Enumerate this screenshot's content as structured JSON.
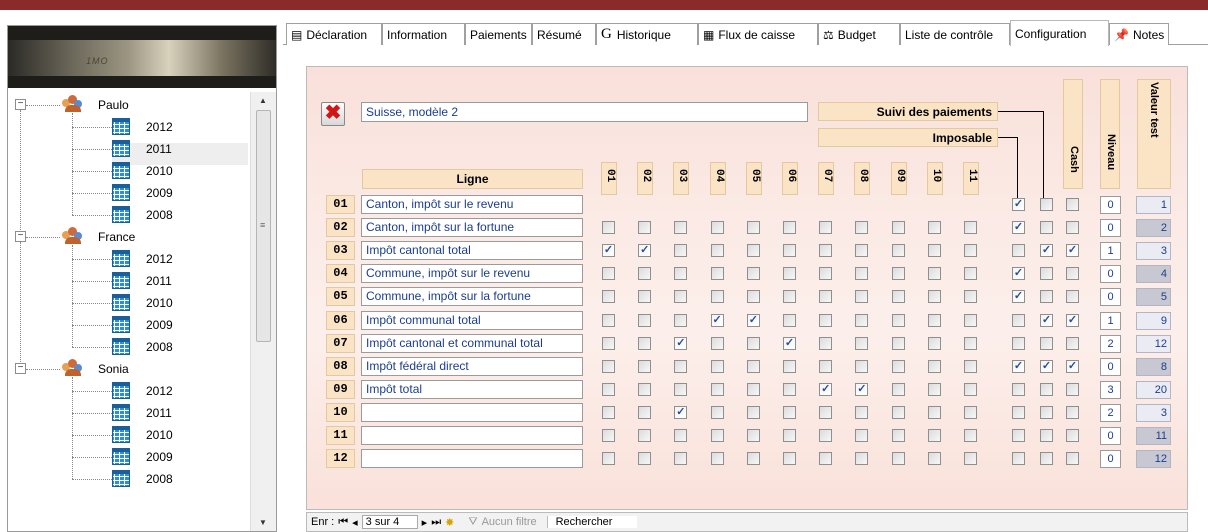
{
  "tree": {
    "banner_text": "1MO",
    "groups": [
      {
        "name": "Paulo",
        "years": [
          "2012",
          "2011",
          "2010",
          "2009",
          "2008"
        ]
      },
      {
        "name": "France",
        "years": [
          "2012",
          "2011",
          "2010",
          "2009",
          "2008"
        ]
      },
      {
        "name": "Sonia",
        "years": [
          "2012",
          "2011",
          "2010",
          "2009",
          "2008"
        ]
      }
    ]
  },
  "tabs": [
    {
      "label": "Déclaration",
      "icon": "form-icon"
    },
    {
      "label": "Information",
      "icon": ""
    },
    {
      "label": "Paiements",
      "icon": ""
    },
    {
      "label": "Résumé",
      "icon": ""
    },
    {
      "label": "Historique",
      "icon": "g-icon"
    },
    {
      "label": "Flux de caisse",
      "icon": "table-icon"
    },
    {
      "label": "Budget",
      "icon": "scale-icon"
    },
    {
      "label": "Liste de contrôle",
      "icon": ""
    },
    {
      "label": "Configuration",
      "icon": ""
    },
    {
      "label": "Notes",
      "icon": "pin-icon"
    }
  ],
  "active_tab": "Configuration",
  "form": {
    "model_name": "Suisse, modèle 2",
    "suivi_label": "Suivi des paiements",
    "imposable_label": "Imposable",
    "ligne_label": "Ligne",
    "cash_label": "Cash",
    "niveau_label": "Niveau",
    "valeur_test_label": "Valeur test",
    "columns": [
      "01",
      "02",
      "03",
      "04",
      "05",
      "06",
      "07",
      "08",
      "09",
      "10",
      "11"
    ],
    "rows": [
      {
        "num": "01",
        "name": "Canton, impôt sur le revenu",
        "checks": [
          0,
          0,
          0,
          0,
          0,
          0,
          0,
          0,
          0,
          0,
          0
        ],
        "visible": [
          0,
          0,
          0,
          0,
          0,
          0,
          0,
          0,
          0,
          0,
          0
        ],
        "imposable": 1,
        "suivi": 0,
        "cash": 0,
        "niveau": "0",
        "valeur": "1"
      },
      {
        "num": "02",
        "name": "Canton, impôt sur la fortune",
        "checks": [
          0,
          0,
          0,
          0,
          0,
          0,
          0,
          0,
          0,
          0,
          0
        ],
        "visible": [
          1,
          1,
          1,
          1,
          1,
          1,
          1,
          1,
          1,
          1,
          1
        ],
        "imposable": 1,
        "suivi": 0,
        "cash": 0,
        "niveau": "0",
        "valeur": "2"
      },
      {
        "num": "03",
        "name": "Impôt cantonal total",
        "checks": [
          1,
          1,
          0,
          0,
          0,
          0,
          0,
          0,
          0,
          0,
          0
        ],
        "visible": [
          1,
          1,
          1,
          1,
          1,
          1,
          1,
          1,
          1,
          1,
          1
        ],
        "imposable": 0,
        "suivi": 1,
        "cash": 1,
        "niveau": "1",
        "valeur": "3"
      },
      {
        "num": "04",
        "name": "Commune, impôt sur le revenu",
        "checks": [
          0,
          0,
          0,
          0,
          0,
          0,
          0,
          0,
          0,
          0,
          0
        ],
        "visible": [
          1,
          1,
          1,
          1,
          1,
          1,
          1,
          1,
          1,
          1,
          1
        ],
        "imposable": 1,
        "suivi": 0,
        "cash": 0,
        "niveau": "0",
        "valeur": "4"
      },
      {
        "num": "05",
        "name": "Commune, impôt sur la fortune",
        "checks": [
          0,
          0,
          0,
          0,
          0,
          0,
          0,
          0,
          0,
          0,
          0
        ],
        "visible": [
          1,
          1,
          1,
          1,
          1,
          1,
          1,
          1,
          1,
          1,
          1
        ],
        "imposable": 1,
        "suivi": 0,
        "cash": 0,
        "niveau": "0",
        "valeur": "5"
      },
      {
        "num": "06",
        "name": "Impôt communal total",
        "checks": [
          0,
          0,
          0,
          1,
          1,
          0,
          0,
          0,
          0,
          0,
          0
        ],
        "visible": [
          1,
          1,
          1,
          1,
          1,
          1,
          1,
          1,
          1,
          1,
          1
        ],
        "imposable": 0,
        "suivi": 1,
        "cash": 1,
        "niveau": "1",
        "valeur": "9"
      },
      {
        "num": "07",
        "name": "Impôt cantonal et communal total",
        "checks": [
          0,
          0,
          1,
          0,
          0,
          1,
          0,
          0,
          0,
          0,
          0
        ],
        "visible": [
          1,
          1,
          1,
          1,
          1,
          1,
          1,
          1,
          1,
          1,
          1
        ],
        "imposable": 0,
        "suivi": 0,
        "cash": 0,
        "niveau": "2",
        "valeur": "12"
      },
      {
        "num": "08",
        "name": "Impôt fédéral direct",
        "checks": [
          0,
          0,
          0,
          0,
          0,
          0,
          0,
          0,
          0,
          0,
          0
        ],
        "visible": [
          1,
          1,
          1,
          1,
          1,
          1,
          1,
          1,
          1,
          1,
          1
        ],
        "imposable": 1,
        "suivi": 1,
        "cash": 1,
        "niveau": "0",
        "valeur": "8"
      },
      {
        "num": "09",
        "name": "Impôt total",
        "checks": [
          0,
          0,
          0,
          0,
          0,
          0,
          1,
          1,
          0,
          0,
          0
        ],
        "visible": [
          1,
          1,
          1,
          1,
          1,
          1,
          1,
          1,
          1,
          1,
          1
        ],
        "imposable": 0,
        "suivi": 0,
        "cash": 0,
        "niveau": "3",
        "valeur": "20"
      },
      {
        "num": "10",
        "name": "",
        "checks": [
          0,
          0,
          1,
          0,
          0,
          0,
          0,
          0,
          0,
          0,
          0
        ],
        "visible": [
          1,
          1,
          1,
          1,
          1,
          1,
          1,
          1,
          1,
          1,
          1
        ],
        "imposable": 0,
        "suivi": 0,
        "cash": 0,
        "niveau": "2",
        "valeur": "3"
      },
      {
        "num": "11",
        "name": "",
        "checks": [
          0,
          0,
          0,
          0,
          0,
          0,
          0,
          0,
          0,
          0,
          0
        ],
        "visible": [
          1,
          1,
          1,
          1,
          1,
          1,
          1,
          1,
          1,
          1,
          1
        ],
        "imposable": 0,
        "suivi": 0,
        "cash": 0,
        "niveau": "0",
        "valeur": "11"
      },
      {
        "num": "12",
        "name": "",
        "checks": [
          0,
          0,
          0,
          0,
          0,
          0,
          0,
          0,
          0,
          0,
          0
        ],
        "visible": [
          1,
          1,
          1,
          1,
          1,
          1,
          1,
          1,
          1,
          1,
          1
        ],
        "imposable": 0,
        "suivi": 0,
        "cash": 0,
        "niveau": "0",
        "valeur": "12"
      }
    ]
  },
  "navigation": {
    "record_label": "Enr :",
    "record_position": "3 sur 4",
    "filter_label": "Aucun filtre",
    "search_label": "Rechercher"
  },
  "colors": {
    "accent_bar": "#8b2a2a",
    "header_fill": "#fbe4c6",
    "value_text": "#1c3d8c",
    "delete_red": "#d21515"
  }
}
